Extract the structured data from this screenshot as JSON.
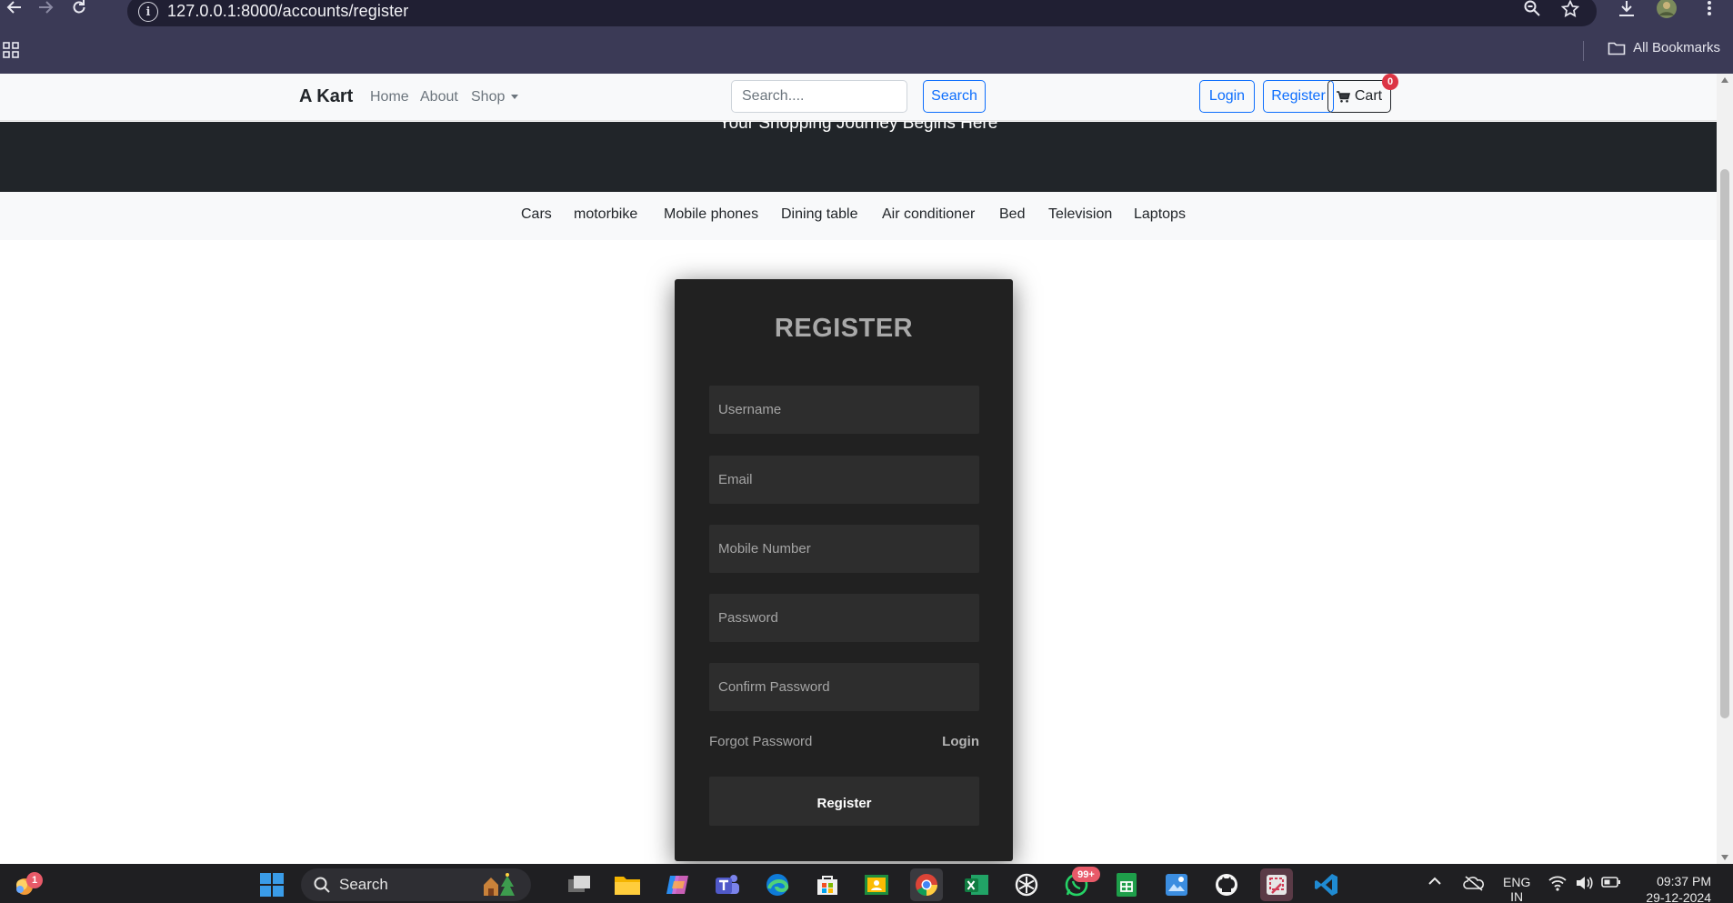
{
  "browser": {
    "url": "127.0.0.1:8000/accounts/register",
    "bookmarks_label": "All Bookmarks"
  },
  "navbar": {
    "brand": "A Kart",
    "links": [
      "Home",
      "About",
      "Shop"
    ],
    "search_placeholder": "Search....",
    "search_button": "Search",
    "login_button": "Login",
    "register_button": "Register",
    "cart_label": "Cart",
    "cart_count": "0"
  },
  "hero": {
    "tagline": "Your Shopping Journey Begins Here"
  },
  "categories": [
    "Cars",
    "motorbike",
    "Mobile phones",
    "Dining table",
    "Air conditioner",
    "Bed",
    "Television",
    "Laptops"
  ],
  "register_form": {
    "title": "REGISTER",
    "username_placeholder": "Username",
    "email_placeholder": "Email",
    "mobile_placeholder": "Mobile Number",
    "password_placeholder": "Password",
    "confirm_password_placeholder": "Confirm Password",
    "forgot_password": "Forgot Password",
    "login_link": "Login",
    "submit": "Register"
  },
  "taskbar": {
    "search_label": "Search",
    "widget_badge": "1",
    "whatsapp_badge": "99+",
    "language_line1": "ENG",
    "language_line2": "IN",
    "time": "09:37 PM",
    "date": "29-12-2024"
  },
  "colors": {
    "chrome": "#3b3a56",
    "omnibox": "#201f33",
    "primary": "#0d6efd",
    "hero": "#212529",
    "card": "#212121",
    "field": "#2d2d2d",
    "badge": "#dc3545",
    "taskbar": "#1f1f22"
  }
}
